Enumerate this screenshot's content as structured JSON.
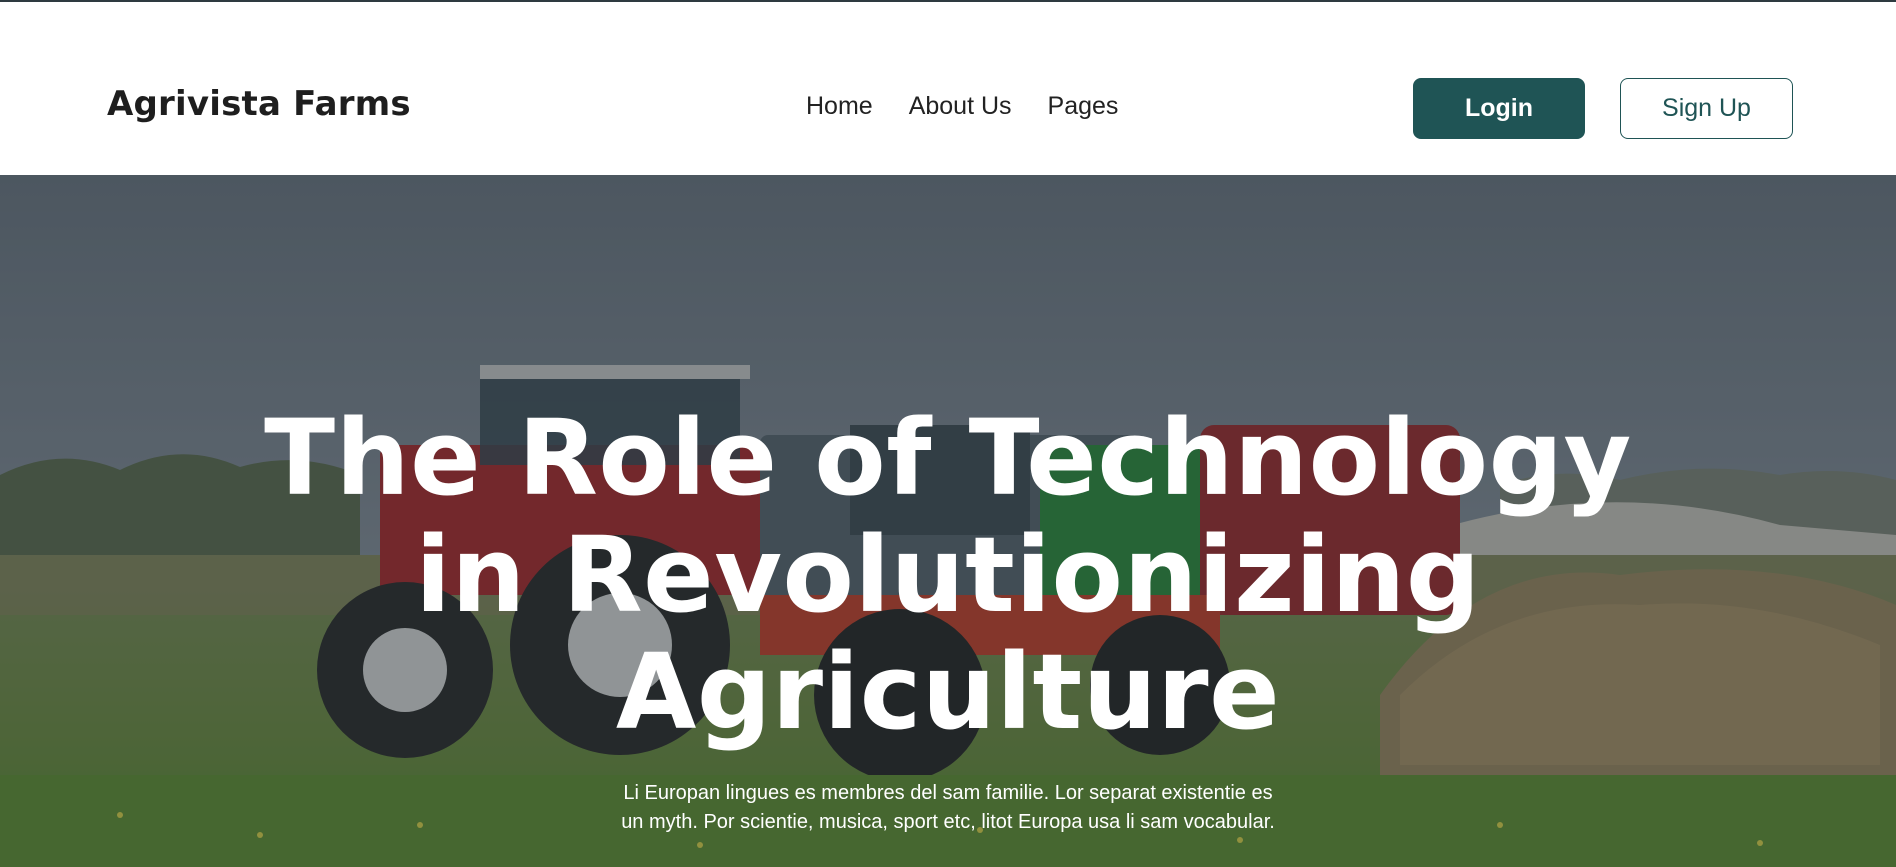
{
  "header": {
    "brand": "Agrivista Farms",
    "nav": [
      "Home",
      "About Us",
      "Pages"
    ],
    "login_label": "Login",
    "signup_label": "Sign Up"
  },
  "hero": {
    "title_lines": [
      "The Role of Technology",
      "in Revolutionizing",
      "Agriculture"
    ],
    "description_lines": [
      "Li Europan lingues es membres del sam familie. Lor separat existentie es",
      "un myth. Por scientie, musica, sport etc, litot Europa usa li sam vocabular."
    ],
    "image": "farm-tractors-field-photo"
  },
  "colors": {
    "accent": "#1f5455",
    "brand_text": "#1e1e1e",
    "hero_text": "#ffffff"
  }
}
